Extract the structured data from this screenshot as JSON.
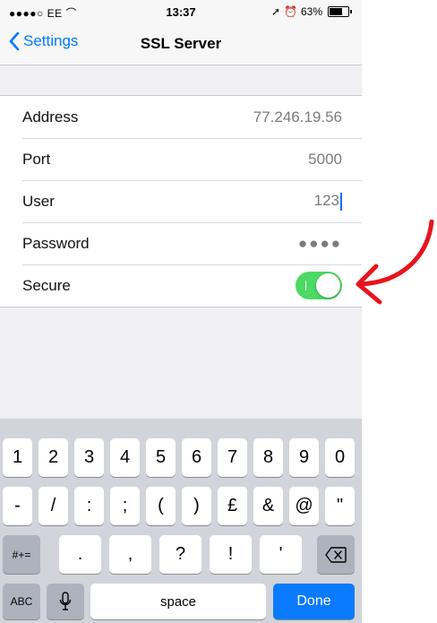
{
  "status_bar": {
    "carrier": "●●●●○ EE",
    "time": "13:37",
    "battery_pct": "63%"
  },
  "nav": {
    "back_label": "Settings",
    "title": "SSL Server"
  },
  "rows": [
    {
      "label": "Address",
      "value": "77.246.19.56"
    },
    {
      "label": "Port",
      "value": "5000"
    },
    {
      "label": "User",
      "value": "123"
    },
    {
      "label": "Password",
      "value": "●●●●"
    },
    {
      "label": "Secure",
      "toggle_on": true
    }
  ],
  "keyboard": {
    "row1": [
      "1",
      "2",
      "3",
      "4",
      "5",
      "6",
      "7",
      "8",
      "9",
      "0"
    ],
    "row2": [
      "-",
      "/",
      ":",
      ";",
      "(",
      ")",
      "£",
      "&",
      "@",
      "\""
    ],
    "row3_mode": "#+=",
    "row3": [
      ".",
      ",",
      "?",
      "!",
      "'"
    ],
    "abc": "ABC",
    "space": "space",
    "done": "Done"
  },
  "colors": {
    "accent": "#0079ff",
    "toggle_on": "#4cd964",
    "annotation": "#e8141c"
  }
}
